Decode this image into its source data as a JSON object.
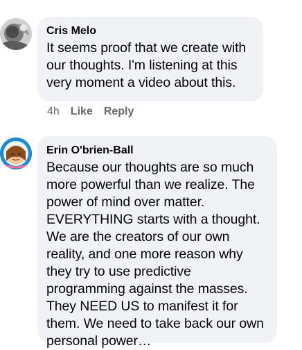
{
  "comments": [
    {
      "author": "Cris Melo",
      "text": "It seems proof that we create with our thoughts. I'm  listening at this very moment a video about this.",
      "time": "4h",
      "like_label": "Like",
      "reply_label": "Reply"
    },
    {
      "author": "Erin O'brien-Ball",
      "text": "Because our thoughts are so much more powerful than we realize. The power of mind over matter. EVERYTHING starts with a thought. We are the creators of our own reality, and one more reason why they try to use predictive programming against the masses. They NEED US to manifest it for them. We need to take back our own personal power…"
    }
  ],
  "colors": {
    "bubble_bg": "#f0f2f5",
    "meta_text": "#65676b"
  }
}
